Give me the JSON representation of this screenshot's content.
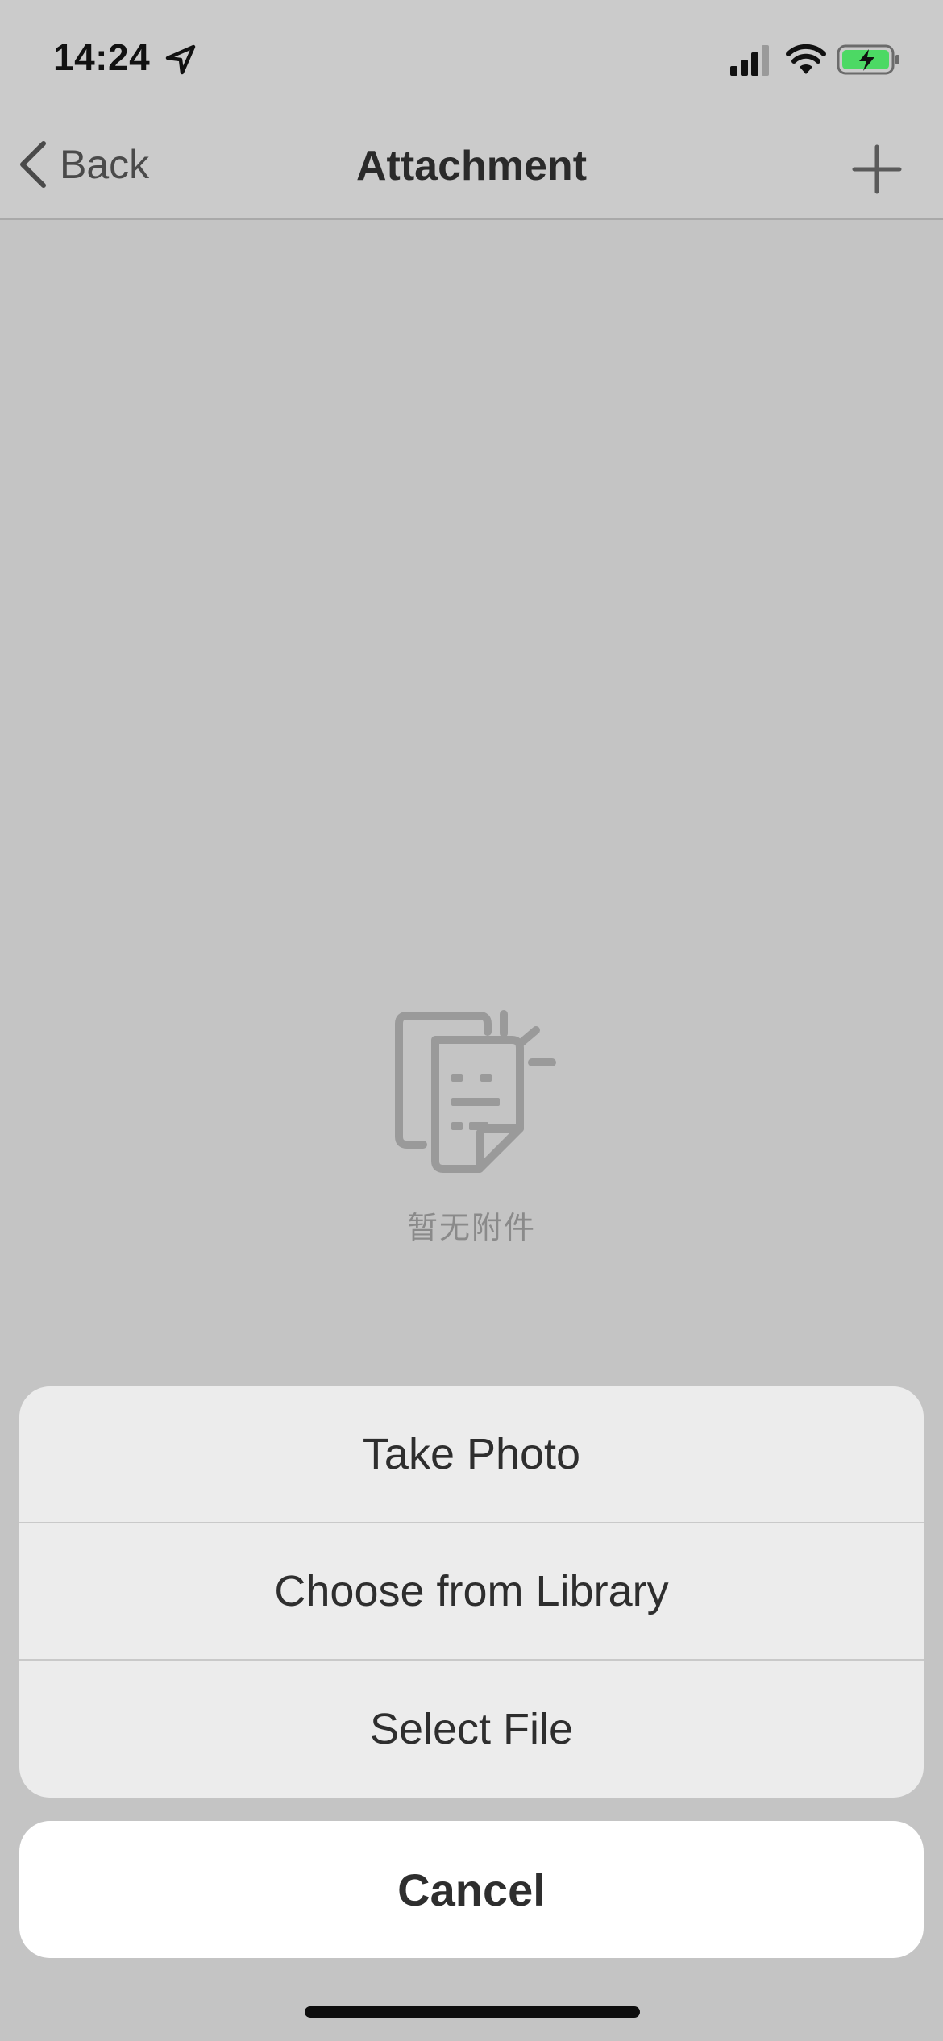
{
  "status_bar": {
    "time": "14:24",
    "icons": [
      "location-arrow-icon",
      "cellular-signal-icon",
      "wifi-icon",
      "battery-charging-icon"
    ],
    "battery_color": "#4cd964"
  },
  "nav": {
    "back_label": "Back",
    "title": "Attachment",
    "add_icon": "plus-icon"
  },
  "empty_state": {
    "icon": "empty-document-icon",
    "text": "暂无附件"
  },
  "action_sheet": {
    "items": [
      {
        "label": "Take Photo"
      },
      {
        "label": "Choose from Library"
      },
      {
        "label": "Select File"
      }
    ],
    "cancel_label": "Cancel"
  },
  "colors": {
    "overlay_background": "#c4c4c4",
    "sheet_background": "#ececec",
    "cancel_background": "#ffffff"
  }
}
